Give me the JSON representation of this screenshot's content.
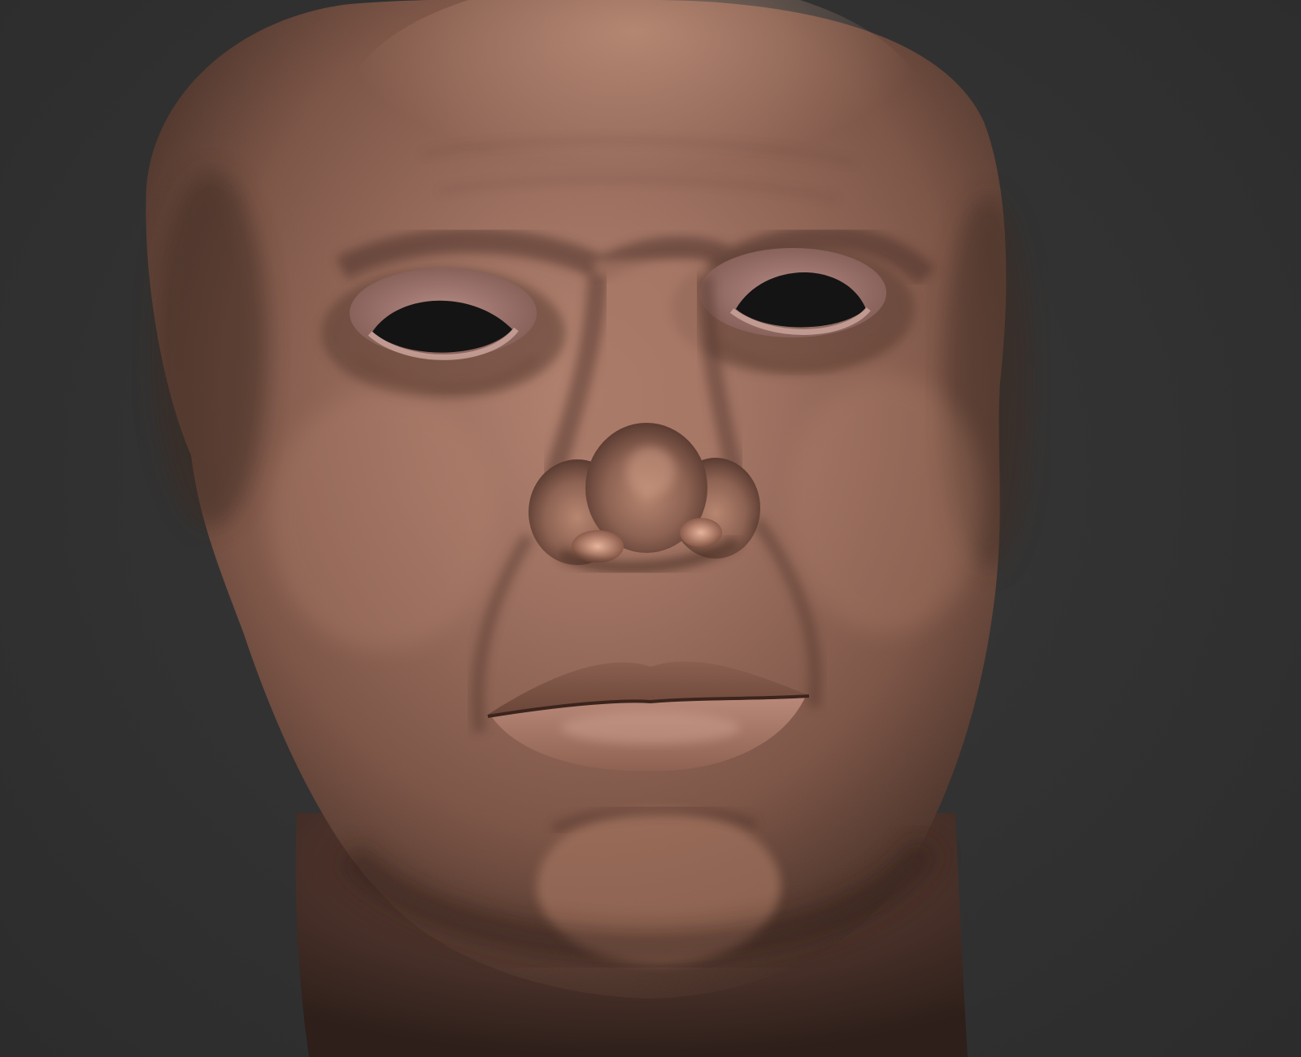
{
  "viewport": {
    "background_color": "#323232",
    "subject": "sculpt-head-mesh"
  },
  "sculpt": {
    "material_color": "#9a6f60",
    "highlight_color": "#d6a48c",
    "shadow_color": "#3a2620",
    "eye_socket_color": "#141414"
  }
}
